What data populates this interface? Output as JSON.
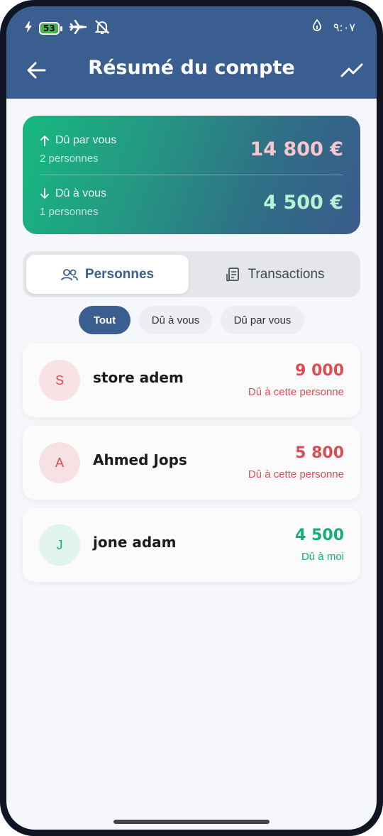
{
  "status_bar": {
    "battery_level": "53",
    "time": "٩:٠٧"
  },
  "header": {
    "title": "Résumé du compte"
  },
  "summary": {
    "owed_by_you_label": "Dû par vous",
    "owed_by_you_sub": "2 personnes",
    "owed_by_you_amount": "14 800 €",
    "owed_to_you_label": "Dû à vous",
    "owed_to_you_sub": "1 personnes",
    "owed_to_you_amount": "4 500 €"
  },
  "tabs": {
    "people": "Personnes",
    "transactions": "Transactions"
  },
  "filters": {
    "all": "Tout",
    "owed_to_you": "Dû à vous",
    "owed_by_you": "Dû par vous"
  },
  "people": [
    {
      "initial": "S",
      "name": "store adem",
      "amount": "9 000",
      "status": "Dû à cette personne"
    },
    {
      "initial": "A",
      "name": "Ahmed Jops",
      "amount": "5 800",
      "status": "Dû à cette personne"
    },
    {
      "initial": "J",
      "name": "jone adam",
      "amount": "4 500",
      "status": "Dû à moi"
    }
  ],
  "colors": {
    "brand": "#3a5e8f",
    "negative": "#dc4c53",
    "positive": "#19ab7c"
  },
  "icons": [
    "charging-bolt-icon",
    "battery-icon",
    "airplane-icon",
    "alarm-off-icon",
    "data-icon",
    "back-arrow-icon",
    "trend-chart-icon",
    "arrow-up-icon",
    "arrow-down-icon",
    "people-icon",
    "receipt-icon"
  ]
}
